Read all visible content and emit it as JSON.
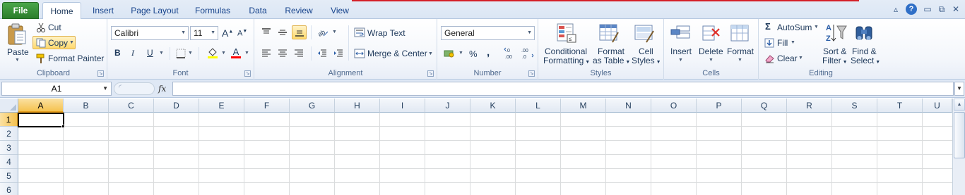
{
  "tabs": {
    "file": "File",
    "items": [
      "Home",
      "Insert",
      "Page Layout",
      "Formulas",
      "Data",
      "Review",
      "View"
    ],
    "active": "Home"
  },
  "window_controls": {
    "minimize_ribbon": "▵",
    "help": "?",
    "minimize": "▭",
    "restore": "⧉",
    "close": "✕"
  },
  "clipboard": {
    "paste": "Paste",
    "cut": "Cut",
    "copy": "Copy",
    "format_painter": "Format Painter",
    "label": "Clipboard"
  },
  "font": {
    "name": "Calibri",
    "size": "11",
    "grow": "A",
    "shrink": "A",
    "bold": "B",
    "italic": "I",
    "underline": "U",
    "label": "Font",
    "fill_color": "#ffff00",
    "font_color": "#ff0000"
  },
  "alignment": {
    "wrap_text": "Wrap Text",
    "merge_center": "Merge & Center",
    "label": "Alignment"
  },
  "number": {
    "format": "General",
    "percent": "%",
    "comma": ",",
    "inc_decimal": ".0 .00",
    "dec_decimal": ".00 .0",
    "label": "Number"
  },
  "styles": {
    "conditional_formatting": [
      "Conditional",
      "Formatting"
    ],
    "format_as_table": [
      "Format",
      "as Table"
    ],
    "cell_styles": [
      "Cell",
      "Styles"
    ],
    "label": "Styles"
  },
  "cells": {
    "insert": "Insert",
    "delete": "Delete",
    "format": "Format",
    "label": "Cells"
  },
  "editing": {
    "autosum": "AutoSum",
    "sigma": "Σ",
    "fill": "Fill",
    "clear": "Clear",
    "sort_filter": [
      "Sort &",
      "Filter"
    ],
    "find_select": [
      "Find &",
      "Select"
    ],
    "label": "Editing"
  },
  "formula_bar": {
    "name_box": "A1",
    "fx": "fx",
    "value": ""
  },
  "grid": {
    "columns": [
      "A",
      "B",
      "C",
      "D",
      "E",
      "F",
      "G",
      "H",
      "I",
      "J",
      "K",
      "L",
      "M",
      "N",
      "O",
      "P",
      "Q",
      "R",
      "S",
      "T",
      "U"
    ],
    "rows": [
      "1",
      "2",
      "3",
      "4",
      "5",
      "6"
    ],
    "active_column": "A",
    "active_row": "1"
  }
}
